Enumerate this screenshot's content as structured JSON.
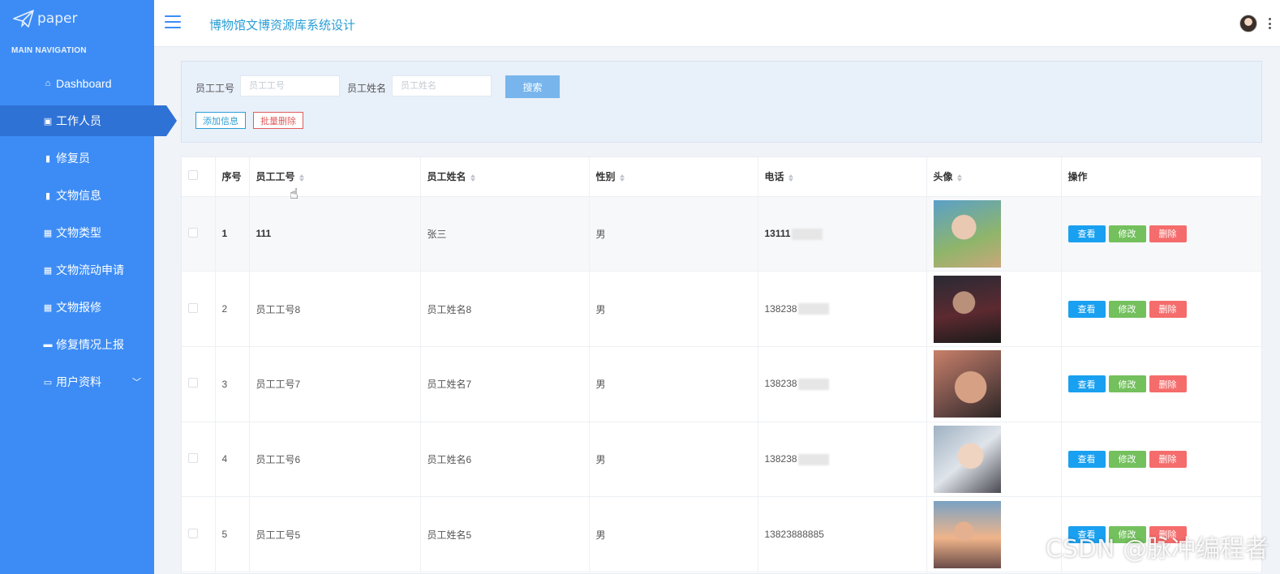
{
  "sidebar": {
    "logo_text": "paper",
    "nav_title": "MAIN NAVIGATION",
    "items": [
      {
        "label": "Dashboard",
        "icon": "home-icon"
      },
      {
        "label": "工作人员",
        "icon": "chart-icon"
      },
      {
        "label": "修复员",
        "icon": "clipboard-icon"
      },
      {
        "label": "文物信息",
        "icon": "clipboard-icon"
      },
      {
        "label": "文物类型",
        "icon": "grid-icon"
      },
      {
        "label": "文物流动申请",
        "icon": "grid-icon"
      },
      {
        "label": "文物报修",
        "icon": "grid-icon"
      },
      {
        "label": "修复情况上报",
        "icon": "comment-icon"
      },
      {
        "label": "用户资料",
        "icon": "window-icon"
      }
    ]
  },
  "header": {
    "title": "博物馆文博资源库系统设计"
  },
  "search": {
    "id_label": "员工工号",
    "id_placeholder": "员工工号",
    "name_label": "员工姓名",
    "name_placeholder": "员工姓名",
    "search_button": "搜索",
    "add_button": "添加信息",
    "batch_delete_button": "批量删除"
  },
  "table": {
    "headers": {
      "index": "序号",
      "emp_id": "员工工号",
      "emp_name": "员工姓名",
      "gender": "性别",
      "phone": "电话",
      "avatar": "头像",
      "actions": "操作"
    },
    "rows": [
      {
        "index": "1",
        "emp_id": "111",
        "emp_name": "张三",
        "gender": "男",
        "phone": "13111"
      },
      {
        "index": "2",
        "emp_id": "员工工号8",
        "emp_name": "员工姓名8",
        "gender": "男",
        "phone": "138238"
      },
      {
        "index": "3",
        "emp_id": "员工工号7",
        "emp_name": "员工姓名7",
        "gender": "男",
        "phone": "138238"
      },
      {
        "index": "4",
        "emp_id": "员工工号6",
        "emp_name": "员工姓名6",
        "gender": "男",
        "phone": "138238"
      },
      {
        "index": "5",
        "emp_id": "员工工号5",
        "emp_name": "员工姓名5",
        "gender": "男",
        "phone": "13823888885"
      }
    ],
    "action_labels": {
      "view": "查看",
      "edit": "修改",
      "delete": "删除"
    }
  },
  "watermark": "CSDN @脉冲编程者",
  "colors": {
    "sidebar": "#3d8cf5",
    "active": "#2f72d6",
    "accent": "#2b9ed6",
    "view": "#1aa0f0",
    "edit": "#73c05d",
    "delete": "#f56c6c"
  }
}
